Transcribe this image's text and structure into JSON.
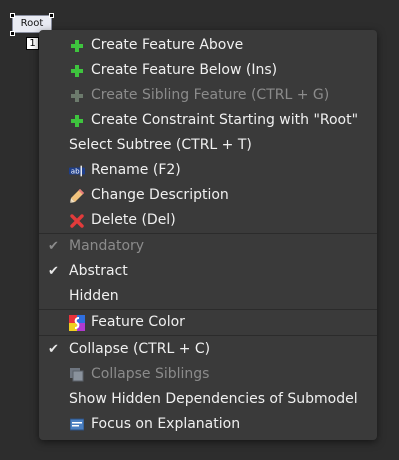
{
  "canvas": {
    "root_node_label": "Root",
    "children_count": "1"
  },
  "menu": {
    "items": [
      {
        "label": "Create Feature Above",
        "icon": "plus-icon"
      },
      {
        "label": "Create Feature Below (Ins)",
        "icon": "plus-icon"
      },
      {
        "label": "Create Sibling Feature (CTRL + G)",
        "icon": "plus-icon",
        "disabled": true
      },
      {
        "label": "Create Constraint Starting with \"Root\"",
        "icon": "plus-icon"
      },
      {
        "label": "Select Subtree (CTRL + T)"
      },
      {
        "label": "Rename (F2)",
        "icon": "rename-icon"
      },
      {
        "label": "Change Description",
        "icon": "pencil-icon"
      },
      {
        "label": "Delete (Del)",
        "icon": "delete-x-icon"
      },
      {
        "label": "Mandatory",
        "checked": true,
        "disabled": true
      },
      {
        "label": "Abstract",
        "checked": true
      },
      {
        "label": "Hidden"
      },
      {
        "label": "Feature Color",
        "icon": "color-palette-icon"
      },
      {
        "label": "Collapse (CTRL + C)",
        "checked": true
      },
      {
        "label": "Collapse Siblings",
        "icon": "collapse-siblings-icon",
        "disabled": true
      },
      {
        "label": "Show Hidden Dependencies of Submodel"
      },
      {
        "label": "Focus on Explanation",
        "icon": "explanation-icon"
      }
    ],
    "check_glyph": "✔"
  },
  "colors": {
    "background": "#2d2d2d",
    "menu_background": "#3a3a3a",
    "plus_green": "#3ec43e",
    "delete_red": "#e23b3b"
  }
}
